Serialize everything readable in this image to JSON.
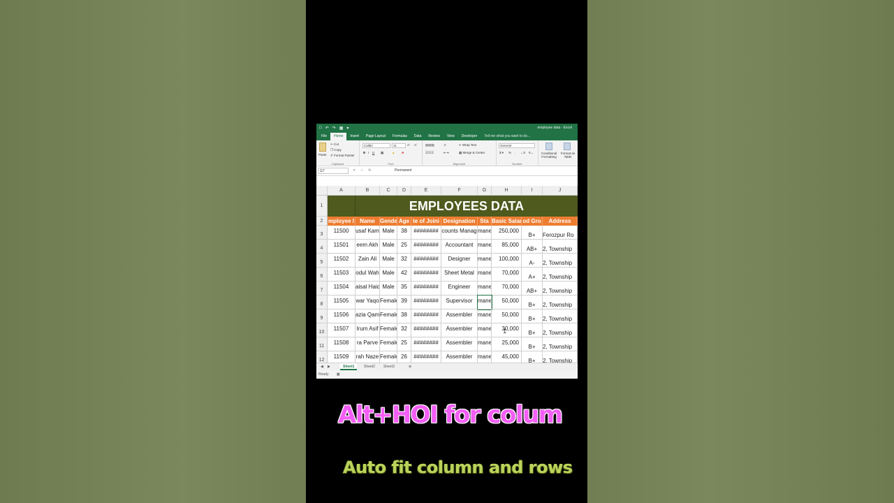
{
  "window": {
    "title": "employee data - Excel"
  },
  "tabs": [
    {
      "label": "File"
    },
    {
      "label": "Home"
    },
    {
      "label": "Insert"
    },
    {
      "label": "Page Layout"
    },
    {
      "label": "Formulas"
    },
    {
      "label": "Data"
    },
    {
      "label": "Review"
    },
    {
      "label": "View"
    },
    {
      "label": "Developer"
    },
    {
      "label": "Tell me what you want to do..."
    }
  ],
  "ribbon": {
    "clipboard": {
      "paste": "Paste",
      "cut": "Cut",
      "copy": "Copy",
      "format_painter": "Format Painter",
      "label": "Clipboard"
    },
    "font": {
      "name": "Calibri",
      "size": "11",
      "label": "Font"
    },
    "alignment": {
      "wrap": "Wrap Text",
      "merge": "Merge & Center",
      "label": "Alignment"
    },
    "number": {
      "format": "General",
      "label": "Number"
    },
    "styles": {
      "conditional": "Conditional Formatting",
      "format_table": "Format as Table"
    }
  },
  "formula_bar": {
    "cell_ref": "G7",
    "content": "Permanent"
  },
  "columns": [
    "A",
    "B",
    "C",
    "D",
    "E",
    "F",
    "G",
    "H",
    "I",
    "J"
  ],
  "banner": "EMPLOYEES DATA",
  "headers": [
    "mployee I",
    "Name",
    "Gende",
    "Age",
    "te of Joini",
    "Designation",
    "Sta",
    "Basic Salar",
    "od Gro",
    "Address"
  ],
  "rows": [
    {
      "n": "3",
      "cells": [
        "11500",
        "usaf Kam",
        "Male",
        "38",
        "########",
        "counts Manag",
        "mane",
        "250,000",
        "B+",
        "Ferozpur Ro"
      ]
    },
    {
      "n": "4",
      "cells": [
        "11501",
        "eem Akh",
        "Male",
        "25",
        "########",
        "Accountant",
        "mane",
        "85,000",
        "AB+",
        "2, Township"
      ]
    },
    {
      "n": "5",
      "cells": [
        "11502",
        "Zain Ali",
        "Male",
        "32",
        "########",
        "Designer",
        "mane",
        "100,000",
        "A-",
        "2, Township"
      ]
    },
    {
      "n": "6",
      "cells": [
        "11503",
        "odul Wah",
        "Male",
        "42",
        "########",
        "Sheet Metal",
        "mane",
        "70,000",
        "A+",
        "2, Township"
      ]
    },
    {
      "n": "7",
      "cells": [
        "11504",
        "aisal Haid",
        "Male",
        "35",
        "########",
        "Engineer",
        "mane",
        "70,000",
        "AB+",
        "2, Township"
      ]
    },
    {
      "n": "8",
      "cells": [
        "11505",
        "war Yaqo",
        "Female",
        "39",
        "########",
        "Supervisor",
        "mane",
        "50,000",
        "B+",
        "2, Township"
      ]
    },
    {
      "n": "9",
      "cells": [
        "11506",
        "azia Qam",
        "Female",
        "38",
        "########",
        "Assembler",
        "mane",
        "50,000",
        "B+",
        "2, Township"
      ]
    },
    {
      "n": "10",
      "cells": [
        "11507",
        "Irum Asif",
        "Female",
        "32",
        "########",
        "Assembler",
        "mane",
        "30,000",
        "B+",
        "2, Township"
      ]
    },
    {
      "n": "11",
      "cells": [
        "11508",
        "ra Parve",
        "Female",
        "25",
        "########",
        "Assembler",
        "mane",
        "25,000",
        "B+",
        "2, Township"
      ]
    },
    {
      "n": "12",
      "cells": [
        "11509",
        "rah Naze",
        "Female",
        "26",
        "########",
        "Assembler",
        "mane",
        "45,000",
        "B+",
        "2, Township"
      ]
    }
  ],
  "sheets": [
    "Sheet1",
    "Sheet2",
    "Sheet3"
  ],
  "status": "Ready",
  "captions": {
    "primary": "Alt+HOI for colum",
    "secondary": "Auto fit column and rows"
  },
  "colors": {
    "excel_green": "#217346",
    "banner": "#4e5a1e",
    "header_orange": "#ed7d31",
    "caption_pink": "#f35ef5",
    "caption_lime": "#bcd35b"
  }
}
